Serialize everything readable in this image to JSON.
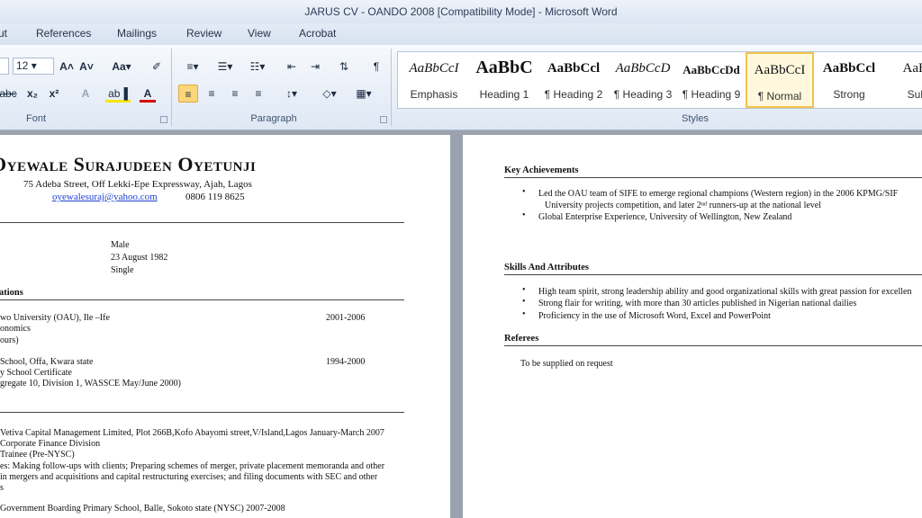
{
  "window": {
    "title": "JARUS CV - OANDO 2008 [Compatibility Mode]  -  Microsoft Word"
  },
  "tabs": [
    "ut",
    "References",
    "Mailings",
    "Review",
    "View",
    "Acrobat"
  ],
  "ribbon": {
    "font_size": "12",
    "groups": {
      "font": "Font",
      "paragraph": "Paragraph",
      "styles": "Styles"
    },
    "glyphs": {
      "grow": "A˄",
      "shrink": "A˅",
      "case": "Aa▾",
      "clear": "✐",
      "abc": "abc",
      "sub": "x₂",
      "sup": "x²",
      "effects": "A",
      "highlight": "ab▐",
      "color": "A",
      "bullets": "≡▾",
      "numbers": "☰▾",
      "multilevel": "☷▾",
      "dec_indent": "⇤",
      "inc_indent": "⇥",
      "sort": "⇅",
      "pilcrow": "¶",
      "align_left": "≡",
      "center": "≡",
      "right": "≡",
      "justify": "≡",
      "spacing": "↕▾",
      "shading": "◇▾",
      "borders": "▦▾"
    },
    "styles": [
      {
        "sample": "AaBbCcI",
        "name": "Emphasis"
      },
      {
        "sample": "AaBbC",
        "name": "Heading 1"
      },
      {
        "sample": "AaBbCcl",
        "name": "¶ Heading 2"
      },
      {
        "sample": "AaBbCcD",
        "name": "¶ Heading 3"
      },
      {
        "sample": "AaBbCcDd",
        "name": "¶ Heading 9"
      },
      {
        "sample": "AaBbCcI",
        "name": "¶ Normal"
      },
      {
        "sample": "AaBbCcl",
        "name": "Strong"
      },
      {
        "sample": "AaBb",
        "name": "Subt"
      }
    ]
  },
  "left_page": {
    "name": "Oyewale Surajudeen Oyetunji",
    "address": "75 Adeba Street, Off Lekki-Epe Expressway, Ajah, Lagos",
    "email": "oyewalesuraj@yahoo.com",
    "phone": "0806 119 8625",
    "personal": [
      "Male",
      "23 August 1982",
      "Single"
    ],
    "qualifications_heading": "ations",
    "edu": [
      {
        "text": "wo University (OAU), Ile –Ife",
        "date": "2001-2006"
      },
      {
        "text": "onomics",
        "date": ""
      },
      {
        "text": "ours)",
        "date": ""
      },
      {
        "text": "School, Offa,  Kwara state",
        "date": "1994-2000"
      },
      {
        "text": "y  School Certificate",
        "date": ""
      },
      {
        "text": "gregate 10, Division 1, WASSCE May/June 2000)",
        "date": ""
      }
    ],
    "experience": [
      "Vetiva Capital Management Limited, Plot 266B,Kofo Abayomi street,V/Island,Lagos   January-March  2007",
      "Corporate Finance Division",
      "Trainee  (Pre-NYSC)",
      "es: Making follow-ups with clients; Preparing schemes of merger, private placement memoranda and other",
      "in mergers and acquisitions and capital restructuring exercises; and filing documents with SEC and other",
      "s",
      "Government Boarding Primary School, Balle, Sokoto state  (NYSC)        2007-2008"
    ]
  },
  "right_page": {
    "achievements_heading": "Key Achievements",
    "achievements": [
      "Led the OAU team of SIFE to emerge regional champions (Western region) in the 2006 KPMG/SIF",
      "University projects competition, and later 2ⁿᵈ runners-up at the national level",
      "Global Enterprise Experience, University of Wellington, New Zealand"
    ],
    "skills_heading": "Skills And Attributes",
    "skills": [
      "High team spirit, strong leadership ability and good organizational skills with great passion for excellen",
      "Strong flair for writing, with more than 30 articles published in Nigerian national dailies",
      "Proficiency in the use of Microsoft Word, Excel and PowerPoint"
    ],
    "referees_heading": "Referees",
    "referees": "To be supplied on request"
  }
}
